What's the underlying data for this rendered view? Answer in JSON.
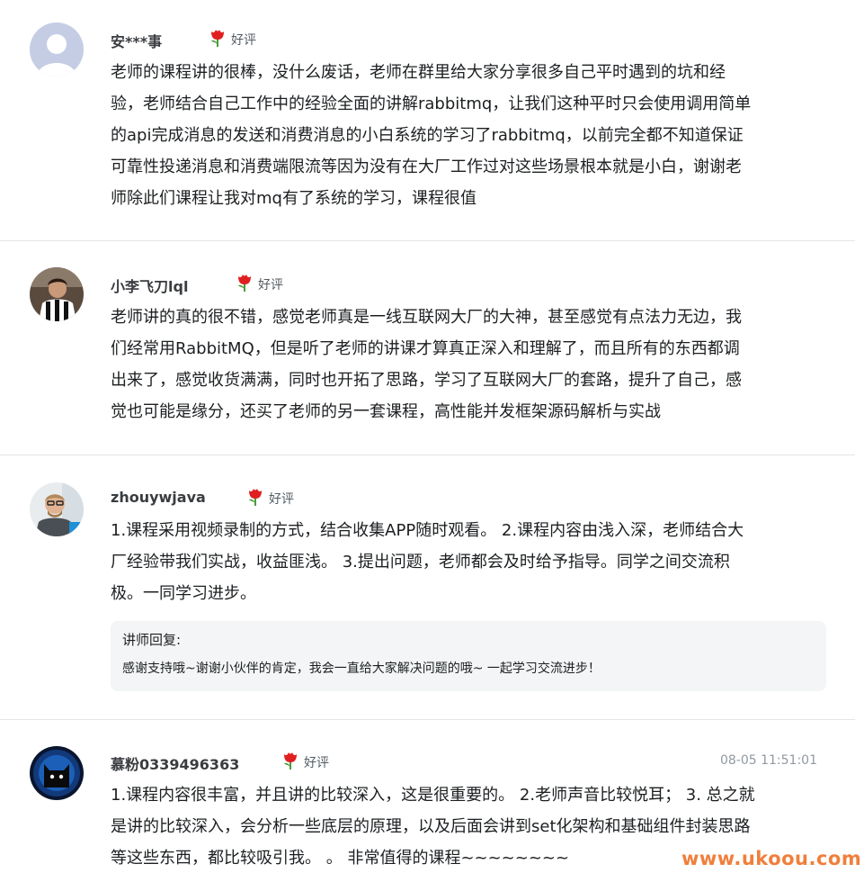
{
  "reviews": [
    {
      "user": "安***事",
      "rating_label": "好评",
      "avatar_icon": "default-user-avatar",
      "lines": [
        "老师的课程讲的很棒，没什么废话，老师在群里给大家分享很多自己平时遇到的坑和经",
        "验，老师结合自己工作中的经验全面的讲解rabbitmq，让我们这种平时只会使用调用简单",
        "的api完成消息的发送和消费消息的小白系统的学习了rabbitmq，以前完全都不知道保证",
        "可靠性投递消息和消费端限流等因为没有在大厂工作过对这些场景根本就是小白，谢谢老",
        "师除此们课程让我对mq有了系统的学习，课程很值"
      ]
    },
    {
      "user": "小李飞刀lql",
      "rating_label": "好评",
      "avatar_icon": "football-player-avatar",
      "lines": [
        "老师讲的真的很不错，感觉老师真是一线互联网大厂的大神，甚至感觉有点法力无边，我",
        "们经常用RabbitMQ，但是听了老师的讲课才算真正深入和理解了，而且所有的东西都调",
        "出来了，感觉收货满满，同时也开拓了思路，学习了互联网大厂的套路，提升了自己，感",
        "觉也可能是缘分，还买了老师的另一套课程，高性能并发框架源码解析与实战"
      ]
    },
    {
      "user": "zhouywjava",
      "rating_label": "好评",
      "avatar_icon": "man-with-glasses-avatar",
      "lines": [
        "1.课程采用视频录制的方式，结合收集APP随时观看。 2.课程内容由浅入深，老师结合大",
        "厂经验带我们实战，收益匪浅。 3.提出问题，老师都会及时给予指导。同学之间交流积",
        "极。一同学习进步。"
      ],
      "reply": {
        "title": "讲师回复:",
        "text": "感谢支持哦~谢谢小伙伴的肯定，我会一直给大家解决问题的哦~ 一起学习交流进步！"
      }
    },
    {
      "user": "慕粉0339496363",
      "rating_label": "好评",
      "avatar_icon": "dark-cat-avatar",
      "timestamp": "08-05 11:51:01",
      "lines": [
        "1.课程内容很丰富，并且讲的比较深入，这是很重要的。 2.老师声音比较悦耳； 3. 总之就",
        "是讲的比较深入，会分析一些底层的原理，以及后面会讲到set化架构和基础组件封装思路",
        "等这些东西，都比较吸引我。 。 非常值得的课程~~~~~~~~"
      ]
    }
  ],
  "watermark": "www.ukoou.com",
  "colors": {
    "accent_watermark": "#f07f3c",
    "rating_flower": "#e02020",
    "divider": "#e3e5e8",
    "reply_bg": "#f3f5f6"
  }
}
